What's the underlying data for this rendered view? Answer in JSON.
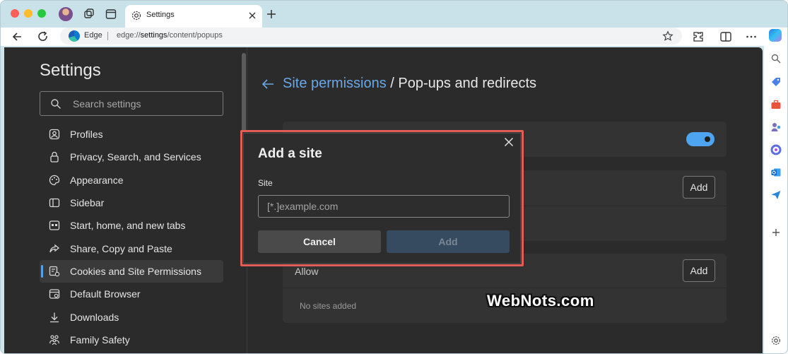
{
  "browser": {
    "tab_title": "Settings",
    "address_brand": "Edge",
    "url_prefix": "edge://",
    "url_highlight": "settings",
    "url_rest": "/content/popups"
  },
  "sidebar": {
    "title": "Settings",
    "search_placeholder": "Search settings",
    "items": [
      {
        "label": "Profiles",
        "icon": "profile-icon"
      },
      {
        "label": "Privacy, Search, and Services",
        "icon": "lock-icon"
      },
      {
        "label": "Appearance",
        "icon": "palette-icon"
      },
      {
        "label": "Sidebar",
        "icon": "sidebar-icon"
      },
      {
        "label": "Start, home, and new tabs",
        "icon": "home-tabs-icon"
      },
      {
        "label": "Share, Copy and Paste",
        "icon": "share-icon"
      },
      {
        "label": "Cookies and Site Permissions",
        "icon": "cookie-permissions-icon",
        "active": true
      },
      {
        "label": "Default Browser",
        "icon": "browser-icon"
      },
      {
        "label": "Downloads",
        "icon": "download-icon"
      },
      {
        "label": "Family Safety",
        "icon": "family-icon"
      }
    ]
  },
  "main": {
    "breadcrumb_link": "Site permissions",
    "breadcrumb_current": " / Pop-ups and redirects",
    "block_add_label": "Add",
    "allow_title": "Allow",
    "allow_add_label": "Add",
    "no_sites": "No sites added"
  },
  "dialog": {
    "title": "Add a site",
    "site_label": "Site",
    "site_placeholder": "[*.]example.com",
    "cancel_label": "Cancel",
    "add_label": "Add"
  },
  "watermark": "WebNots.com",
  "colors": {
    "accent": "#6aa7e6",
    "highlight_border": "#e35d56",
    "toggle_on": "#4ea4ee"
  }
}
